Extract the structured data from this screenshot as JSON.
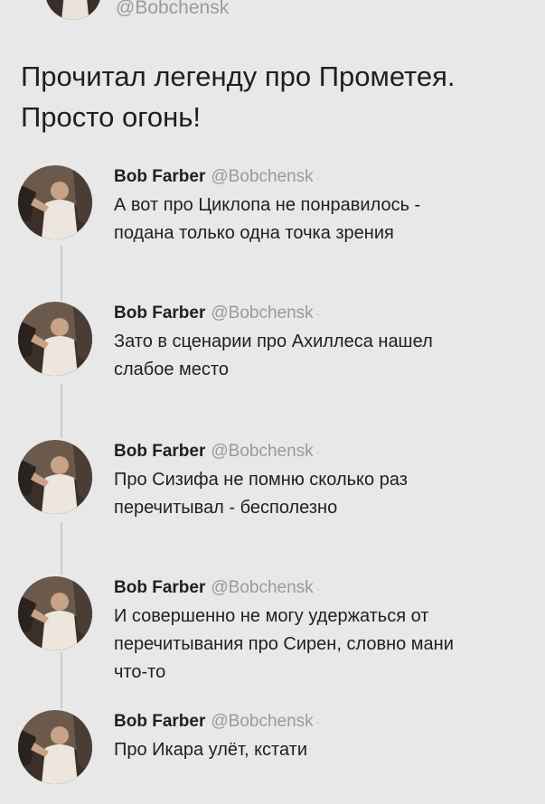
{
  "top_tweet": {
    "handle": "@Bobchensk",
    "text_lines": [
      "Прочитал легенду про Прометея.",
      "Просто огонь!"
    ]
  },
  "replies": [
    {
      "name": "Bob Farber",
      "handle": "@Bobchensk",
      "separator": "·",
      "lines": [
        "А вот про Циклопа не понравилось -",
        "подана только одна точка зрения"
      ]
    },
    {
      "name": "Bob Farber",
      "handle": "@Bobchensk",
      "separator": "·",
      "lines": [
        "Зато в сценарии про Ахиллеса нашел",
        "слабое место"
      ]
    },
    {
      "name": "Bob Farber",
      "handle": "@Bobchensk",
      "separator": "·",
      "lines": [
        "Про Сизифа не помню сколько раз",
        "перечитывал - бесполезно"
      ]
    },
    {
      "name": "Bob Farber",
      "handle": "@Bobchensk",
      "separator": "·",
      "lines": [
        "И совершенно не могу удержаться от",
        "перечитывания про Сирен, словно мани",
        "что-то"
      ]
    },
    {
      "name": "Bob Farber",
      "handle": "@Bobchensk",
      "separator": "·",
      "lines": [
        "Про Икара улёт, кстати"
      ]
    }
  ],
  "icons": {
    "avatar": "avatar-photo-icon"
  },
  "colors": {
    "background": "#e8e8e9",
    "text": "#1f1f1f",
    "muted": "#9a9a9a",
    "thread_line": "#c9c9cb"
  }
}
